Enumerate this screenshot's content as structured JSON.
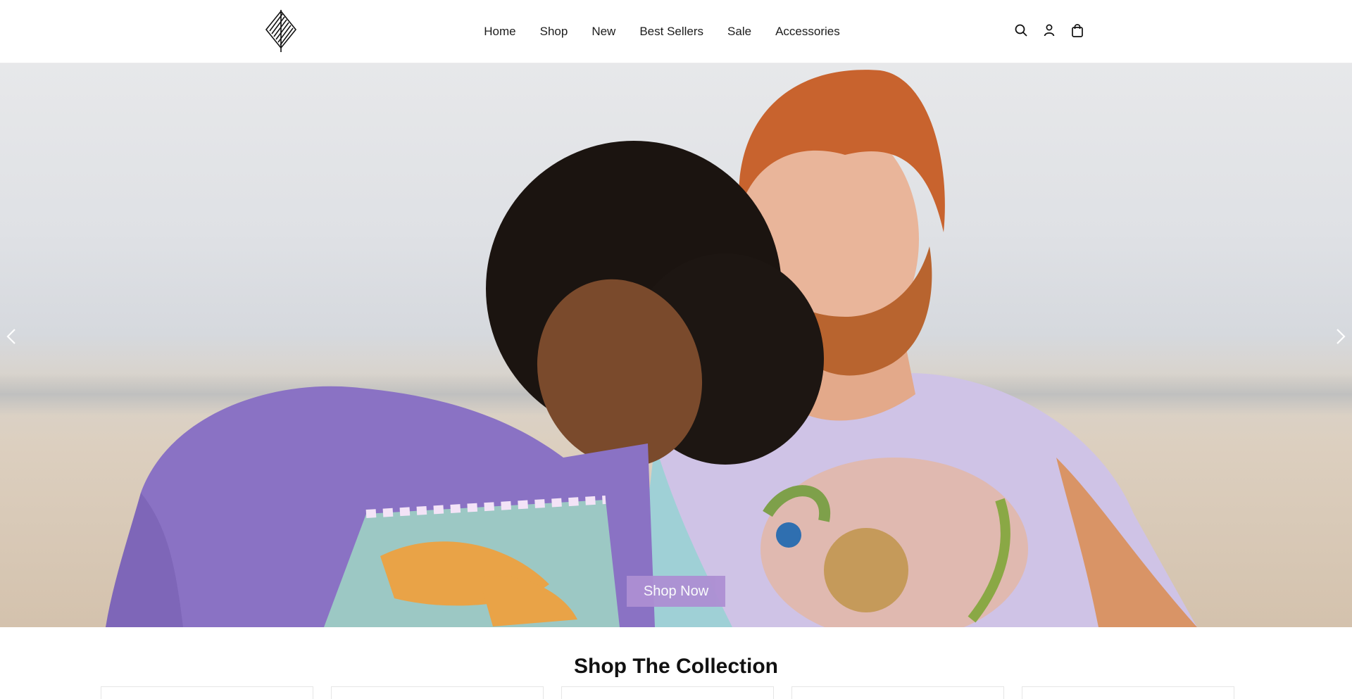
{
  "header": {
    "logo_icon": "diamond-feather-logo-icon",
    "nav": [
      {
        "label": "Home"
      },
      {
        "label": "Shop"
      },
      {
        "label": "New"
      },
      {
        "label": "Best Sellers"
      },
      {
        "label": "Sale"
      },
      {
        "label": "Accessories"
      }
    ],
    "icons": [
      "search-icon",
      "account-icon",
      "cart-bag-icon"
    ]
  },
  "hero": {
    "cta_label": "Shop Now",
    "cta_color": "#ad8fd3",
    "prev_icon": "chevron-left-icon",
    "next_icon": "chevron-right-icon"
  },
  "collection": {
    "title": "Shop The Collection",
    "card_count_visible": 5
  }
}
